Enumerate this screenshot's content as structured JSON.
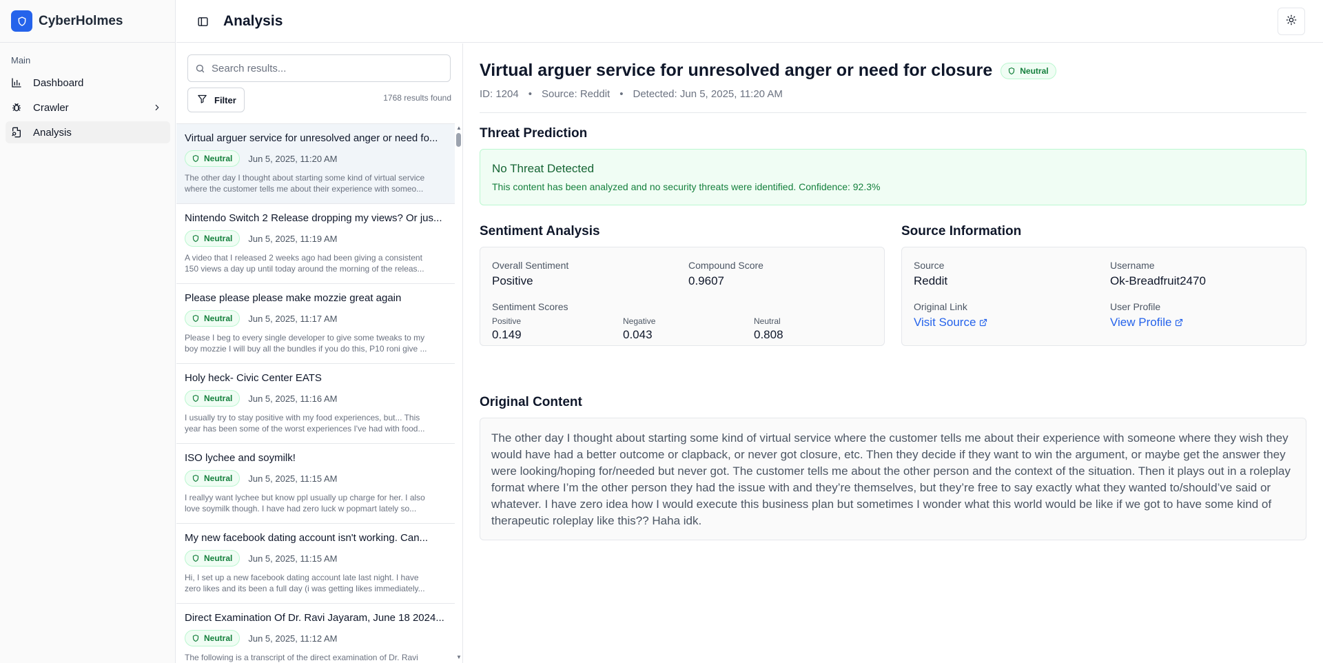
{
  "app": {
    "name": "CyberHolmes",
    "brand_color": "#2563eb"
  },
  "sidebar": {
    "section_label": "Main",
    "items": [
      {
        "label": "Dashboard",
        "icon": "bar-chart-icon"
      },
      {
        "label": "Crawler",
        "icon": "bug-icon",
        "has_submenu": true
      },
      {
        "label": "Analysis",
        "icon": "file-search-icon",
        "active": true
      }
    ]
  },
  "header": {
    "title": "Analysis"
  },
  "search": {
    "placeholder": "Search results...",
    "value": ""
  },
  "filter": {
    "label": "Filter"
  },
  "results": {
    "count_text": "1768 results found",
    "items": [
      {
        "title": "Virtual arguer service for unresolved anger or need fo...",
        "badge": "Neutral",
        "date": "Jun 5, 2025, 11:20 AM",
        "snippet_1": "The other day I thought about starting some kind of virtual service",
        "snippet_2": "where the customer tells me about their experience with someo...",
        "selected": true
      },
      {
        "title": "Nintendo Switch 2 Release dropping my views? Or jus...",
        "badge": "Neutral",
        "date": "Jun 5, 2025, 11:19 AM",
        "snippet_1": "A video that I released 2 weeks ago had been giving a consistent",
        "snippet_2": "150 views a day up until today around the morning of the releas..."
      },
      {
        "title": "Please please please make mozzie great again",
        "badge": "Neutral",
        "date": "Jun 5, 2025, 11:17 AM",
        "snippet_1": "Please I beg to every single developer to give some tweaks to my",
        "snippet_2": "boy mozzie I will buy all the bundles if you do this, P10 roni give ..."
      },
      {
        "title": "Holy heck- Civic Center EATS",
        "badge": "Neutral",
        "date": "Jun 5, 2025, 11:16 AM",
        "snippet_1": "I usually try to stay positive with my food experiences, but... This",
        "snippet_2": "year has been some of the worst experiences I've had with food..."
      },
      {
        "title": "ISO lychee and soymilk!",
        "badge": "Neutral",
        "date": "Jun 5, 2025, 11:15 AM",
        "snippet_1": "I reallyy want lychee but know ppl usually up charge for her. I also",
        "snippet_2": "love soymilk though. I have had zero luck w popmart lately so..."
      },
      {
        "title": "My new facebook dating account isn't working. Can...",
        "badge": "Neutral",
        "date": "Jun 5, 2025, 11:15 AM",
        "snippet_1": "Hi, I set up a new facebook dating account late last night. I have",
        "snippet_2": "zero likes and its been a full day (i was getting likes immediately..."
      },
      {
        "title": "Direct Examination Of Dr. Ravi Jayaram, June 18 2024...",
        "badge": "Neutral",
        "date": "Jun 5, 2025, 11:12 AM",
        "snippet_1": "The following is a transcript of the direct examination of Dr. Ravi",
        "snippet_2": ""
      }
    ]
  },
  "detail": {
    "title": "Virtual arguer service for unresolved anger or need for closure",
    "badge": "Neutral",
    "id_text": "ID: 1204",
    "source_text": "Source: Reddit",
    "detected_text": "Detected: Jun 5, 2025, 11:20 AM",
    "threat": {
      "heading": "Threat Prediction",
      "status": "No Threat Detected",
      "description": "This content has been analyzed and no security threats were identified. Confidence: 92.3%"
    },
    "sentiment": {
      "heading": "Sentiment Analysis",
      "overall_label": "Overall Sentiment",
      "overall_value": "Positive",
      "compound_label": "Compound Score",
      "compound_value": "0.9607",
      "scores_label": "Sentiment Scores",
      "positive_label": "Positive",
      "positive_value": "0.149",
      "negative_label": "Negative",
      "negative_value": "0.043",
      "neutral_label": "Neutral",
      "neutral_value": "0.808"
    },
    "source_info": {
      "heading": "Source Information",
      "source_label": "Source",
      "source_value": "Reddit",
      "username_label": "Username",
      "username_value": "Ok-Breadfruit2470",
      "link_label": "Original Link",
      "link_text": "Visit Source",
      "profile_label": "User Profile",
      "profile_text": "View Profile"
    },
    "content": {
      "heading": "Original Content",
      "text": "The other day I thought about starting some kind of virtual service where the customer tells me about their experience with someone where they wish they would have had a better outcome or clapback, or never got closure, etc. Then they decide if they want to win the argument, or maybe get the answer they were looking/hoping for/needed but never got. The customer tells me about the other person and the context of the situation. Then it plays out in a roleplay format where I’m the other person they had the issue with and they’re themselves, but they’re free to say exactly what they wanted to/should’ve said or whatever. I have zero idea how I would execute this business plan but sometimes I wonder what this world would be like if we got to have some kind of therapeutic roleplay like this?? Haha idk."
    }
  },
  "colors": {
    "neutral_badge_text": "#15803d",
    "neutral_badge_bg": "#f0fdf4",
    "link": "#2563eb"
  }
}
